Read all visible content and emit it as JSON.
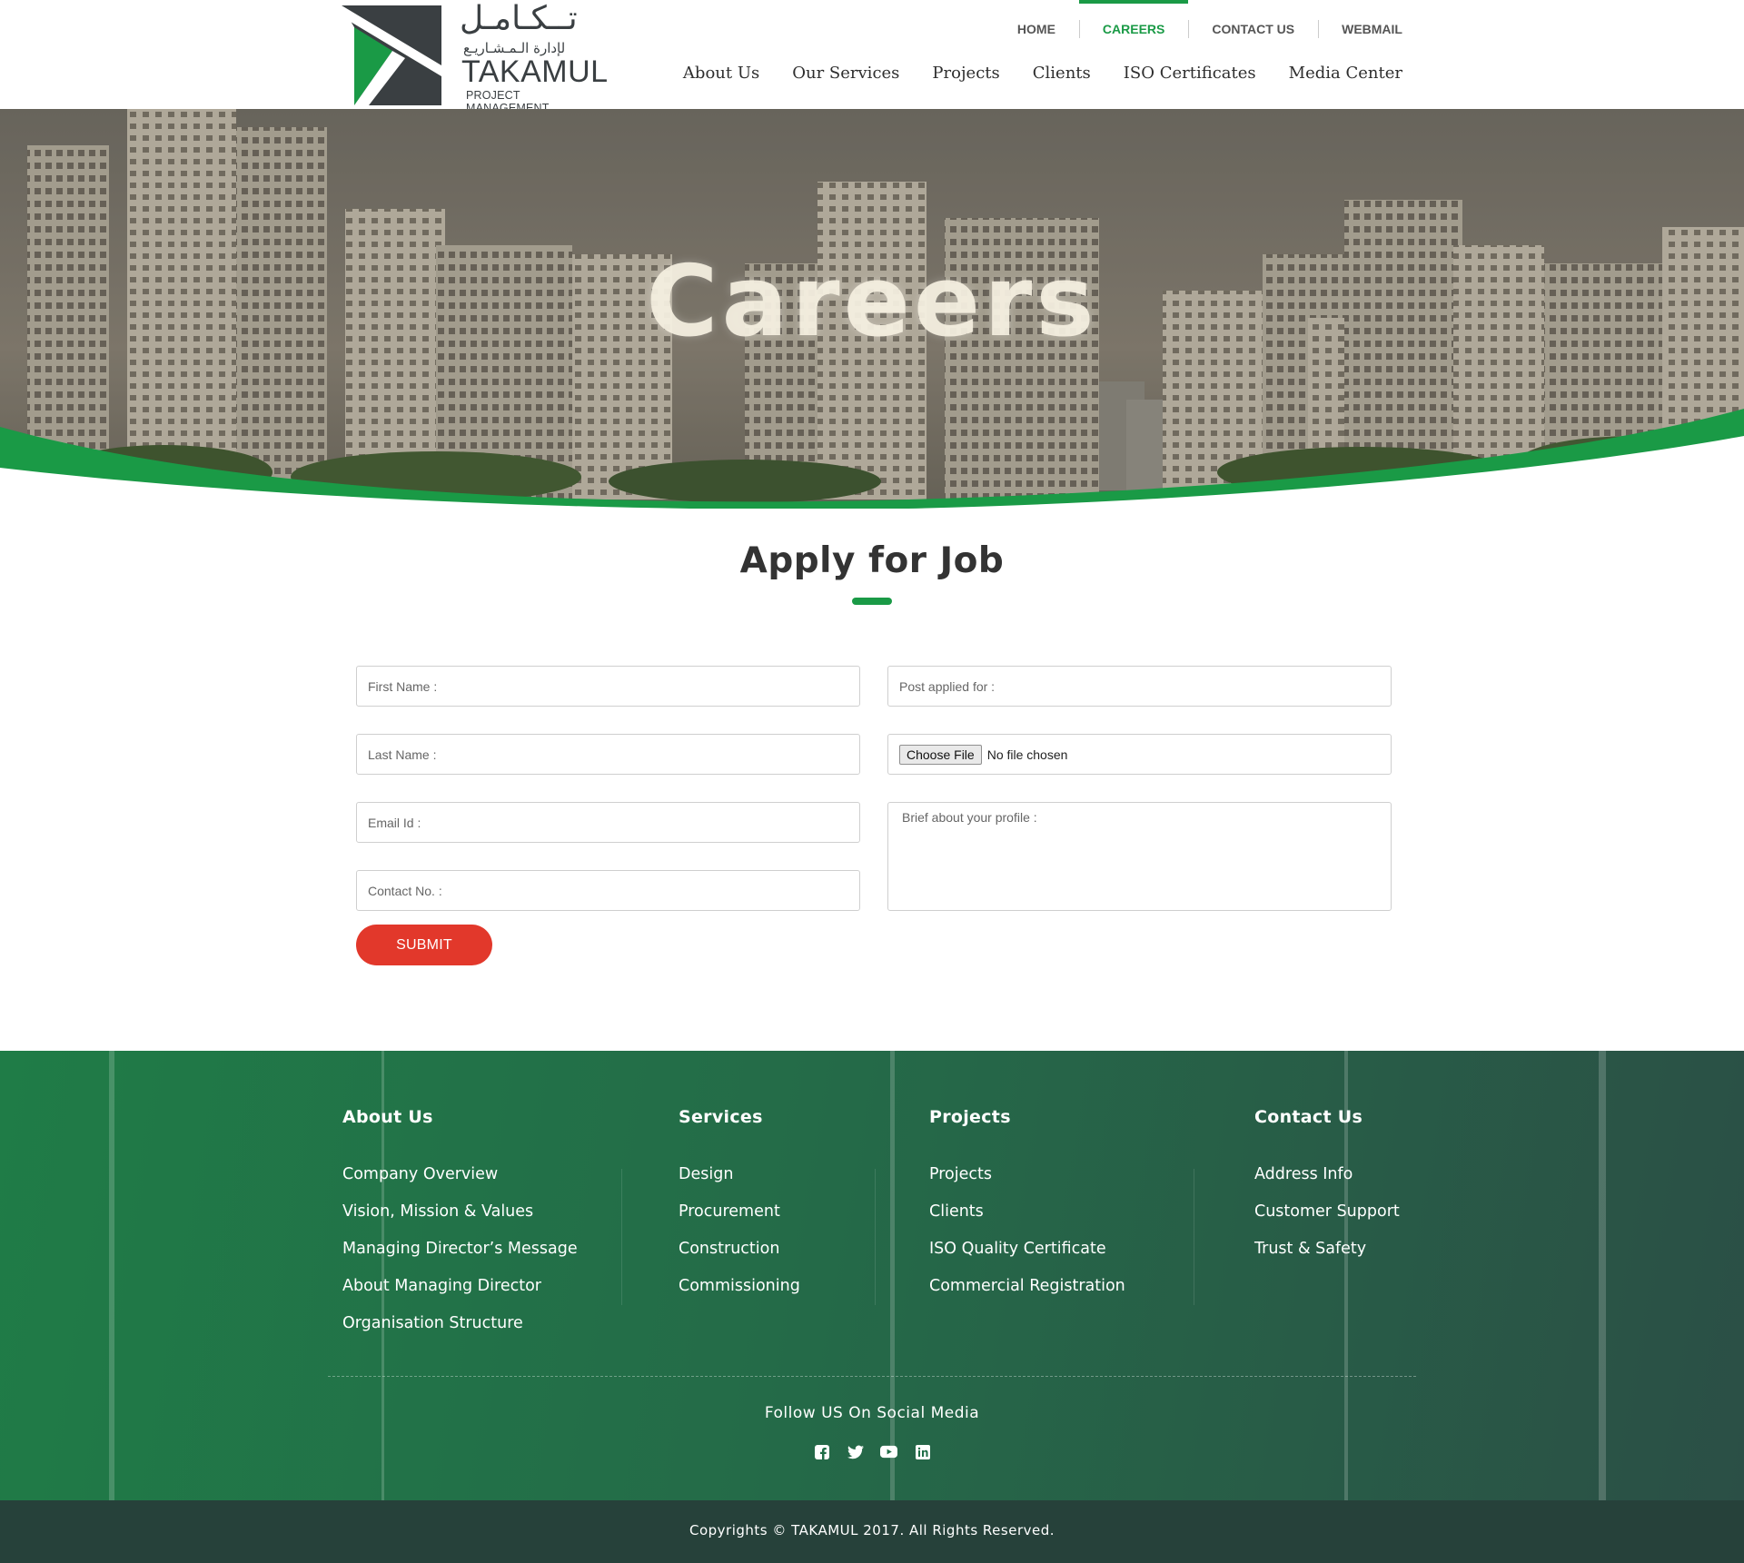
{
  "brand": {
    "arabic_name": "تــكـامـل",
    "arabic_tagline": "لإدارة الـمـشـاريـع",
    "name": "TAKAMUL",
    "tagline": "PROJECT MANAGEMENT"
  },
  "top_nav": [
    "HOME",
    "CAREERS",
    "CONTACT US",
    "WEBMAIL"
  ],
  "top_nav_active": "CAREERS",
  "main_nav": [
    "About Us",
    "Our Services",
    "Projects",
    "Clients",
    "ISO Certificates",
    "Media Center"
  ],
  "hero": {
    "title": "Careers"
  },
  "form": {
    "title": "Apply for Job",
    "first_name_placeholder": "First Name :",
    "last_name_placeholder": "Last Name :",
    "email_placeholder": "Email Id :",
    "contact_placeholder": "Contact No. :",
    "post_placeholder": "Post applied for :",
    "file_button": "Choose File",
    "file_status": "No file chosen",
    "brief_placeholder": "Brief about your profile :",
    "submit": "SUBMIT"
  },
  "footer": {
    "about": {
      "title": "About Us",
      "links": [
        "Company Overview",
        "Vision, Mission & Values",
        "Managing Director’s Message",
        "About Managing Director",
        "Organisation Structure"
      ]
    },
    "services": {
      "title": "Services",
      "links": [
        "Design",
        "Procurement",
        "Construction",
        "Commissioning"
      ]
    },
    "projects": {
      "title": "Projects",
      "links": [
        "Projects",
        "Clients",
        "ISO Quality Certificate",
        "Commercial Registration"
      ]
    },
    "contact": {
      "title": "Contact Us",
      "links": [
        "Address Info",
        "Customer Support",
        "Trust & Safety"
      ]
    },
    "follow": "Follow US On Social Media",
    "social_icons": [
      "facebook-icon",
      "twitter-icon",
      "youtube-icon",
      "linkedin-icon"
    ],
    "copyright": "Copyrights © TAKAMUL 2017. All Rights Reserved."
  },
  "colors": {
    "brand_green": "#1a9a46",
    "submit_red": "#e2382b",
    "logo_dark": "#3a3f42"
  }
}
